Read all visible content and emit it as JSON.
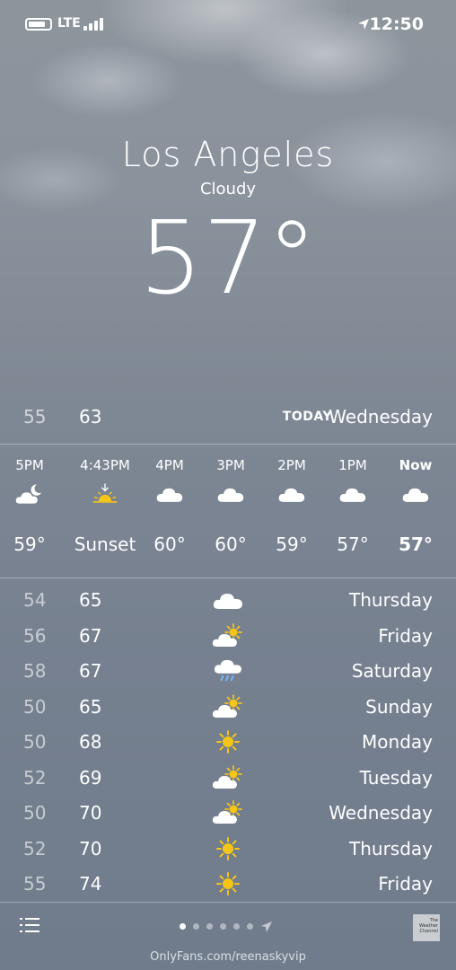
{
  "status_bar": {
    "time": "12:50",
    "network": "LTE"
  },
  "location": {
    "city": "Los Angeles",
    "condition": "Cloudy",
    "temperature": "57°"
  },
  "today": {
    "day": "Wednesday",
    "label": "TODAY",
    "high": "63",
    "low": "55"
  },
  "hourly": [
    {
      "time": "Now",
      "icon": "cloud-icon",
      "temp": "57°",
      "bold": true
    },
    {
      "time": "1PM",
      "icon": "cloud-icon",
      "temp": "57°"
    },
    {
      "time": "2PM",
      "icon": "cloud-icon",
      "temp": "59°"
    },
    {
      "time": "3PM",
      "icon": "cloud-icon",
      "temp": "60°"
    },
    {
      "time": "4PM",
      "icon": "cloud-icon",
      "temp": "60°"
    },
    {
      "time": "4:43PM",
      "icon": "sunset-icon",
      "temp": "Sunset"
    },
    {
      "time": "5PM",
      "icon": "partly-cloudy-night-icon",
      "temp": "59°"
    }
  ],
  "daily": [
    {
      "day": "Thursday",
      "icon": "cloud-icon",
      "high": "65",
      "low": "54"
    },
    {
      "day": "Friday",
      "icon": "partly-cloudy-icon",
      "high": "67",
      "low": "56"
    },
    {
      "day": "Saturday",
      "icon": "rain-icon",
      "high": "67",
      "low": "58"
    },
    {
      "day": "Sunday",
      "icon": "partly-cloudy-icon",
      "high": "65",
      "low": "50"
    },
    {
      "day": "Monday",
      "icon": "sun-icon",
      "high": "68",
      "low": "50"
    },
    {
      "day": "Tuesday",
      "icon": "partly-cloudy-icon",
      "high": "69",
      "low": "52"
    },
    {
      "day": "Wednesday",
      "icon": "partly-cloudy-icon",
      "high": "70",
      "low": "50"
    },
    {
      "day": "Thursday",
      "icon": "sun-icon",
      "high": "70",
      "low": "52"
    },
    {
      "day": "Friday",
      "icon": "sun-icon",
      "high": "74",
      "low": "55"
    }
  ],
  "bottom_bar": {
    "page_count": 6,
    "active_page": 0,
    "weather_channel_logo": "The Weather Channel"
  },
  "watermark": "OnlyFans.com/reenaskyvip",
  "colors": {
    "sun": "#f5c518",
    "text": "#ffffff"
  }
}
